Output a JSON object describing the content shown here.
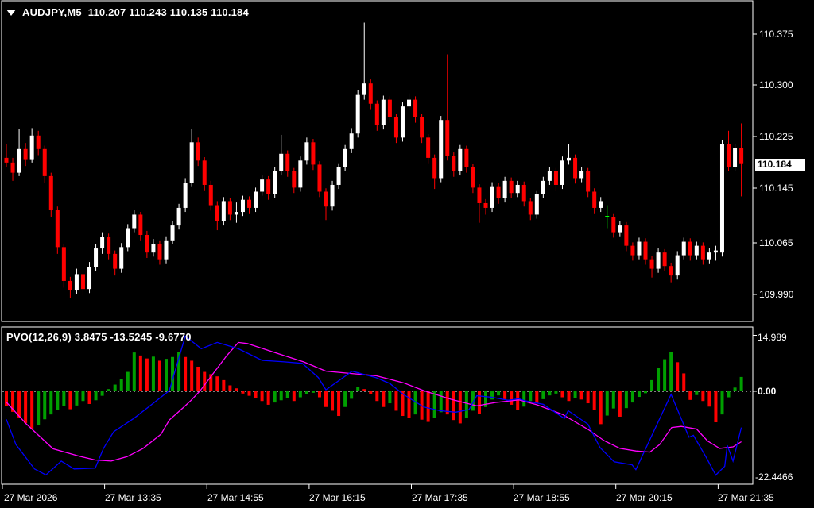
{
  "window": {
    "dropdown_icon": "triangle-down",
    "symbol_period": "AUDJPY,M5",
    "ohlc_text": "110.207 110.243 110.135 110.184"
  },
  "price_axis": {
    "labels": [
      "110.375",
      "110.300",
      "110.225",
      "110.145",
      "110.065",
      "109.990"
    ],
    "current_price_tag": "110.184"
  },
  "indicator_panel": {
    "label": "PVO(12,26,9) 3.8475 -13.5245 -9.6770",
    "axis_max": "14.989",
    "axis_zero": "0.00",
    "axis_min": "-22.4466"
  },
  "time_axis": {
    "labels": [
      "27 Mar 2026",
      "27 Mar 13:35",
      "27 Mar 14:55",
      "27 Mar 16:15",
      "27 Mar 17:35",
      "27 Mar 18:55",
      "27 Mar 20:15",
      "27 Mar 21:35"
    ]
  },
  "colors": {
    "background": "#000000",
    "border": "#FFFFFF",
    "text": "#FFFFFF",
    "bull_candle": "#FFFFFF",
    "bear_candle": "#FF0000",
    "doji_candle": "#00FF00",
    "hist_up": "#00A000",
    "hist_down": "#FF0000",
    "pvo_line": "#0000FF",
    "signal_line": "#FF00FF",
    "zero_line": "#FFFFFF",
    "price_tag_bg": "#FFFFFF",
    "price_tag_text": "#000000"
  },
  "chart_data": [
    {
      "type": "candlestick",
      "title": "AUDJPY M5",
      "ylim": [
        109.91,
        110.425
      ],
      "candles_ohlc": [
        [
          110.192,
          110.213,
          110.178,
          110.185
        ],
        [
          110.185,
          110.192,
          110.158,
          110.17
        ],
        [
          110.17,
          110.235,
          110.165,
          110.205
        ],
        [
          110.205,
          110.214,
          110.18,
          110.19
        ],
        [
          110.19,
          110.236,
          110.185,
          110.225
        ],
        [
          110.225,
          110.232,
          110.196,
          110.205
        ],
        [
          110.205,
          110.21,
          110.155,
          110.165
        ],
        [
          110.165,
          110.17,
          110.105,
          110.115
        ],
        [
          110.115,
          110.12,
          110.05,
          110.06
        ],
        [
          110.06,
          110.065,
          110.0,
          110.01
        ],
        [
          110.01,
          110.016,
          109.985,
          109.997
        ],
        [
          109.997,
          110.028,
          109.99,
          110.02
        ],
        [
          110.02,
          110.026,
          109.988,
          109.998
        ],
        [
          109.998,
          110.038,
          109.992,
          110.03
        ],
        [
          110.03,
          110.065,
          110.024,
          110.058
        ],
        [
          110.058,
          110.082,
          110.05,
          110.075
        ],
        [
          110.075,
          110.08,
          110.042,
          110.05
        ],
        [
          110.05,
          110.055,
          110.018,
          110.028
        ],
        [
          110.028,
          110.066,
          110.022,
          110.06
        ],
        [
          110.06,
          110.094,
          110.054,
          110.088
        ],
        [
          110.088,
          110.115,
          110.082,
          110.108
        ],
        [
          110.108,
          110.112,
          110.07,
          110.078
        ],
        [
          110.078,
          110.084,
          110.044,
          110.052
        ],
        [
          110.052,
          110.072,
          110.046,
          110.065
        ],
        [
          110.065,
          110.07,
          110.034,
          110.042
        ],
        [
          110.042,
          110.076,
          110.036,
          110.07
        ],
        [
          110.07,
          110.098,
          110.064,
          110.092
        ],
        [
          110.092,
          110.124,
          110.086,
          110.118
        ],
        [
          110.118,
          110.162,
          110.112,
          110.155
        ],
        [
          110.155,
          110.235,
          110.15,
          110.215
        ],
        [
          110.215,
          110.222,
          110.18,
          110.188
        ],
        [
          110.188,
          110.193,
          110.144,
          110.152
        ],
        [
          110.152,
          110.158,
          110.114,
          110.122
        ],
        [
          110.122,
          110.128,
          110.085,
          110.098
        ],
        [
          110.098,
          110.134,
          110.092,
          110.128
        ],
        [
          110.128,
          110.133,
          110.1,
          110.108
        ],
        [
          110.108,
          110.126,
          110.096,
          110.112
        ],
        [
          110.112,
          110.136,
          110.106,
          110.13
        ],
        [
          110.13,
          110.135,
          110.11,
          110.118
        ],
        [
          110.118,
          110.148,
          110.112,
          110.142
        ],
        [
          110.142,
          110.166,
          110.136,
          110.16
        ],
        [
          110.16,
          110.165,
          110.13,
          110.138
        ],
        [
          110.138,
          110.178,
          110.132,
          110.172
        ],
        [
          110.172,
          110.226,
          110.166,
          110.198
        ],
        [
          110.198,
          110.203,
          110.164,
          110.172
        ],
        [
          110.172,
          110.177,
          110.14,
          110.148
        ],
        [
          110.148,
          110.194,
          110.142,
          110.188
        ],
        [
          110.188,
          110.222,
          110.182,
          110.215
        ],
        [
          110.215,
          110.22,
          110.174,
          110.182
        ],
        [
          110.182,
          110.187,
          110.134,
          110.142
        ],
        [
          110.142,
          110.147,
          110.1,
          110.12
        ],
        [
          110.12,
          110.158,
          110.114,
          110.152
        ],
        [
          110.152,
          110.184,
          110.146,
          110.178
        ],
        [
          110.178,
          110.211,
          110.172,
          110.205
        ],
        [
          110.205,
          110.236,
          110.199,
          110.228
        ],
        [
          110.228,
          110.292,
          110.222,
          110.285
        ],
        [
          110.285,
          110.392,
          110.278,
          110.302
        ],
        [
          110.302,
          110.308,
          110.264,
          110.272
        ],
        [
          110.272,
          110.277,
          110.232,
          110.24
        ],
        [
          110.24,
          110.284,
          110.234,
          110.278
        ],
        [
          110.278,
          110.283,
          110.244,
          110.252
        ],
        [
          110.252,
          110.257,
          110.214,
          110.222
        ],
        [
          110.222,
          110.274,
          110.216,
          110.268
        ],
        [
          110.268,
          110.288,
          110.262,
          110.278
        ],
        [
          110.278,
          110.283,
          110.244,
          110.252
        ],
        [
          110.252,
          110.257,
          110.214,
          110.222
        ],
        [
          110.222,
          110.227,
          110.184,
          110.192
        ],
        [
          110.192,
          110.197,
          110.146,
          110.162
        ],
        [
          110.162,
          110.254,
          110.156,
          110.248
        ],
        [
          110.248,
          110.345,
          110.188,
          110.195
        ],
        [
          110.195,
          110.2,
          110.164,
          110.172
        ],
        [
          110.172,
          110.211,
          110.166,
          110.205
        ],
        [
          110.205,
          110.21,
          110.17,
          110.178
        ],
        [
          110.178,
          110.183,
          110.14,
          110.148
        ],
        [
          110.148,
          110.153,
          110.096,
          110.125
        ],
        [
          110.125,
          110.131,
          110.108,
          110.118
        ],
        [
          110.118,
          110.156,
          110.112,
          110.15
        ],
        [
          110.15,
          110.155,
          110.124,
          110.132
        ],
        [
          110.132,
          110.164,
          110.126,
          110.158
        ],
        [
          110.158,
          110.163,
          110.132,
          110.14
        ],
        [
          110.14,
          110.158,
          110.134,
          110.152
        ],
        [
          110.152,
          110.157,
          110.12,
          110.128
        ],
        [
          110.128,
          110.133,
          110.1,
          110.108
        ],
        [
          110.108,
          110.144,
          110.102,
          110.138
        ],
        [
          110.138,
          110.164,
          110.132,
          110.158
        ],
        [
          110.158,
          110.178,
          110.152,
          110.172
        ],
        [
          110.172,
          110.177,
          110.144,
          110.152
        ],
        [
          110.152,
          110.194,
          110.146,
          110.188
        ],
        [
          110.188,
          110.212,
          110.182,
          110.192
        ],
        [
          110.192,
          110.197,
          110.154,
          110.162
        ],
        [
          110.162,
          110.178,
          110.156,
          110.172
        ],
        [
          110.172,
          110.177,
          110.134,
          110.142
        ],
        [
          110.142,
          110.147,
          110.11,
          110.118
        ],
        [
          110.118,
          110.134,
          110.112,
          110.128
        ],
        [
          110.105,
          110.122,
          110.088,
          110.105
        ],
        [
          110.105,
          110.11,
          110.074,
          110.082
        ],
        [
          110.082,
          110.098,
          110.076,
          110.092
        ],
        [
          110.092,
          110.097,
          110.054,
          110.062
        ],
        [
          110.062,
          110.067,
          110.04,
          110.048
        ],
        [
          110.048,
          110.074,
          110.042,
          110.068
        ],
        [
          110.068,
          110.073,
          110.034,
          110.042
        ],
        [
          110.042,
          110.047,
          110.015,
          110.028
        ],
        [
          110.028,
          110.058,
          110.022,
          110.052
        ],
        [
          110.052,
          110.057,
          110.024,
          110.032
        ],
        [
          110.032,
          110.037,
          110.008,
          110.018
        ],
        [
          110.018,
          110.054,
          110.012,
          110.048
        ],
        [
          110.048,
          110.074,
          110.042,
          110.068
        ],
        [
          110.068,
          110.073,
          110.04,
          110.048
        ],
        [
          110.048,
          110.068,
          110.042,
          110.062
        ],
        [
          110.062,
          110.067,
          110.034,
          110.042
        ],
        [
          110.042,
          110.058,
          110.036,
          110.052
        ],
        [
          110.052,
          110.062,
          110.04,
          110.055
        ],
        [
          110.052,
          110.218,
          110.046,
          110.212
        ],
        [
          110.212,
          110.232,
          110.172,
          110.178
        ],
        [
          110.178,
          110.213,
          110.172,
          110.207
        ],
        [
          110.207,
          110.243,
          110.135,
          110.184
        ]
      ]
    },
    {
      "type": "bar",
      "title": "PVO(12,26,9) histogram",
      "ylim": [
        -22.4466,
        14.989
      ],
      "values": [
        -4.0,
        -5.5,
        -7.0,
        -8.5,
        -10.0,
        -9.0,
        -7.5,
        -6.2,
        -5.0,
        -4.0,
        -4.8,
        -3.8,
        -2.6,
        -3.4,
        -2.4,
        -1.2,
        0.6,
        1.8,
        3.2,
        5.2,
        10.4,
        9.6,
        8.8,
        9.3,
        8.2,
        8.7,
        9.2,
        10.6,
        9.2,
        8.2,
        6.6,
        5.2,
        4.6,
        4.0,
        3.0,
        1.6,
        0.8,
        -0.6,
        -1.2,
        -1.8,
        -2.6,
        -3.6,
        -3.0,
        -2.4,
        -1.9,
        -2.6,
        -1.6,
        -0.7,
        -0.4,
        -1.6,
        -4.2,
        -5.2,
        -6.6,
        -4.2,
        -2.0,
        1.1,
        0.6,
        -0.7,
        -2.6,
        -4.2,
        -3.2,
        -5.2,
        -6.6,
        -7.2,
        -6.2,
        -7.6,
        -8.2,
        -7.1,
        -5.6,
        -6.2,
        -7.7,
        -8.6,
        -7.1,
        -5.2,
        -6.1,
        -4.2,
        -2.2,
        -1.1,
        -2.1,
        -3.6,
        -5.1,
        -4.1,
        -2.6,
        -3.1,
        -2.1,
        -1.1,
        -0.6,
        -1.6,
        -2.6,
        -1.7,
        -2.2,
        -3.2,
        -5.0,
        -8.8,
        -6.5,
        -4.6,
        -6.8,
        -4.5,
        -3.0,
        -1.5,
        -0.5,
        3.0,
        6.2,
        8.6,
        10.5,
        7.8,
        4.8,
        -2.3,
        -1.0,
        -2.6,
        -4.1,
        -8.3,
        -6.2,
        -1.6,
        1.0,
        3.85
      ]
    },
    {
      "type": "line",
      "title": "PVO line (blue)",
      "points_index_value": [
        [
          0,
          -7.5
        ],
        [
          1.5,
          -14.3
        ],
        [
          4.4,
          -20.8
        ],
        [
          6.2,
          -22.4
        ],
        [
          8.6,
          -18.7
        ],
        [
          10.6,
          -20.8
        ],
        [
          13.9,
          -20.6
        ],
        [
          15.2,
          -15.3
        ],
        [
          16.8,
          -10.8
        ],
        [
          20,
          -7.2
        ],
        [
          23,
          -3.2
        ],
        [
          25.5,
          0.2
        ],
        [
          28,
          14.8
        ],
        [
          30.5,
          11.4
        ],
        [
          33,
          13.1
        ],
        [
          36.3,
          11.4
        ],
        [
          40,
          8.3
        ],
        [
          43.5,
          7.9
        ],
        [
          46.3,
          7.5
        ],
        [
          48.8,
          3.7
        ],
        [
          50,
          0.4
        ],
        [
          54.1,
          5.4
        ],
        [
          56.2,
          4.4
        ],
        [
          57.8,
          3.7
        ],
        [
          60,
          2.1
        ],
        [
          62.1,
          -0.8
        ],
        [
          65.3,
          -4.2
        ],
        [
          67.8,
          -5.2
        ],
        [
          70.3,
          -5.6
        ],
        [
          72.4,
          -4.9
        ],
        [
          73.6,
          -1.2
        ],
        [
          76,
          -1.6
        ],
        [
          78.5,
          -2.4
        ],
        [
          80.2,
          -2.0
        ],
        [
          81.3,
          -2.6
        ],
        [
          84,
          -3.5
        ],
        [
          87.3,
          -7.3
        ],
        [
          87.9,
          -5.2
        ],
        [
          91,
          -8.8
        ],
        [
          92.9,
          -15.1
        ],
        [
          95.1,
          -18.9
        ],
        [
          97.9,
          -19.7
        ],
        [
          98.5,
          -21.0
        ],
        [
          104,
          -0.8
        ],
        [
          106.8,
          -12.3
        ],
        [
          107.5,
          -11.8
        ],
        [
          109.4,
          -17.4
        ],
        [
          111,
          -22.45
        ],
        [
          112.4,
          -20.1
        ],
        [
          112.8,
          -14.5
        ],
        [
          113.7,
          -18.7
        ],
        [
          115,
          -9.7
        ]
      ]
    },
    {
      "type": "line",
      "title": "Signal line (magenta)",
      "points_index_value": [
        [
          0,
          -2.9
        ],
        [
          3.1,
          -8.7
        ],
        [
          7.3,
          -15.4
        ],
        [
          11.4,
          -17.4
        ],
        [
          13.9,
          -18.4
        ],
        [
          16.4,
          -18.7
        ],
        [
          18.9,
          -17.5
        ],
        [
          21.4,
          -15.3
        ],
        [
          24.2,
          -11.5
        ],
        [
          25.5,
          -7.7
        ],
        [
          27.6,
          -4.5
        ],
        [
          28.9,
          -2.4
        ],
        [
          30.3,
          0.1
        ],
        [
          33,
          6.2
        ],
        [
          34.5,
          9.6
        ],
        [
          36.3,
          13.1
        ],
        [
          37.7,
          12.8
        ],
        [
          42.5,
          10.1
        ],
        [
          46.5,
          7.9
        ],
        [
          50,
          5.4
        ],
        [
          53.7,
          4.8
        ],
        [
          57.8,
          4.2
        ],
        [
          62.1,
          2.3
        ],
        [
          65.3,
          0.2
        ],
        [
          69.5,
          -2.1
        ],
        [
          73.6,
          -3.9
        ],
        [
          76.5,
          -3.0
        ],
        [
          80.2,
          -2.3
        ],
        [
          83,
          -3.6
        ],
        [
          87,
          -6.2
        ],
        [
          91,
          -10.2
        ],
        [
          93.5,
          -13.2
        ],
        [
          96,
          -15.3
        ],
        [
          98.5,
          -16.0
        ],
        [
          100.7,
          -16.3
        ],
        [
          102.2,
          -14.3
        ],
        [
          104.1,
          -9.7
        ],
        [
          105.6,
          -9.4
        ],
        [
          108,
          -10.1
        ],
        [
          109.7,
          -13.3
        ],
        [
          111.6,
          -15.3
        ],
        [
          113.7,
          -14.9
        ],
        [
          115,
          -13.5
        ]
      ]
    }
  ]
}
